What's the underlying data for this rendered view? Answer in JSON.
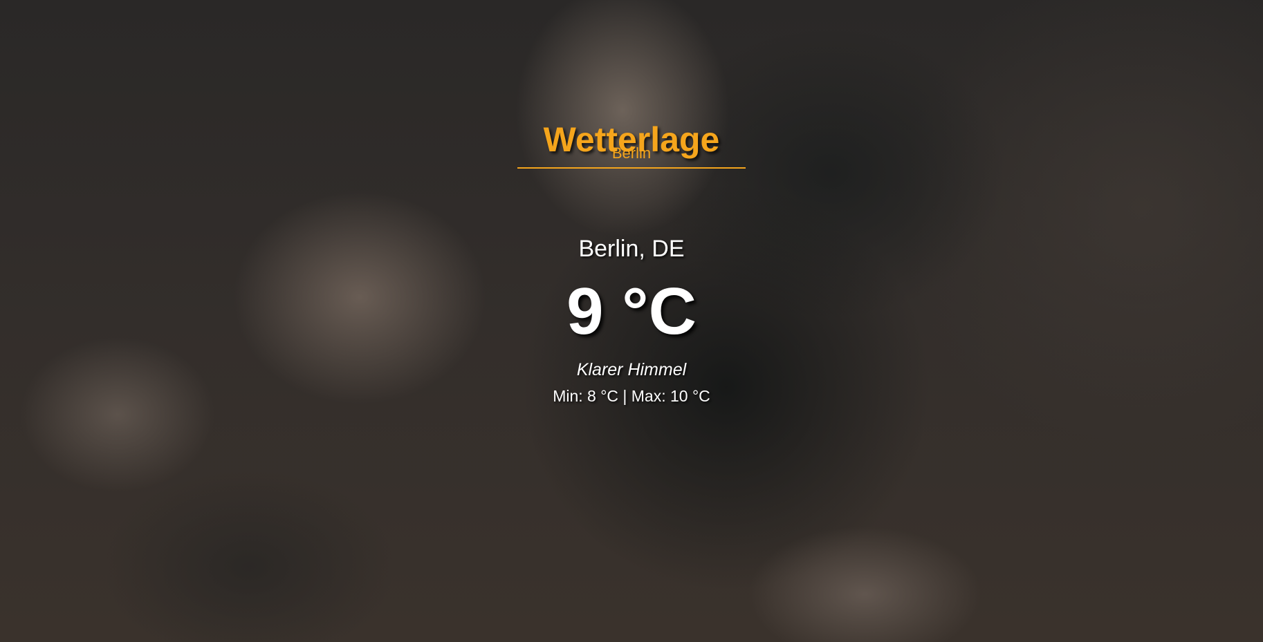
{
  "app": {
    "title": "Wetterlage"
  },
  "search": {
    "value": "Berlin",
    "placeholder": ""
  },
  "weather": {
    "location": "Berlin, DE",
    "temperature": "9 °C",
    "condition": "Klarer Himmel",
    "minmax": "Min: 8 °C | Max: 10 °C"
  },
  "colors": {
    "accent": "#f5a51c",
    "text": "#ffffff"
  },
  "background": {
    "description_icon": "storm-cloud-background"
  }
}
